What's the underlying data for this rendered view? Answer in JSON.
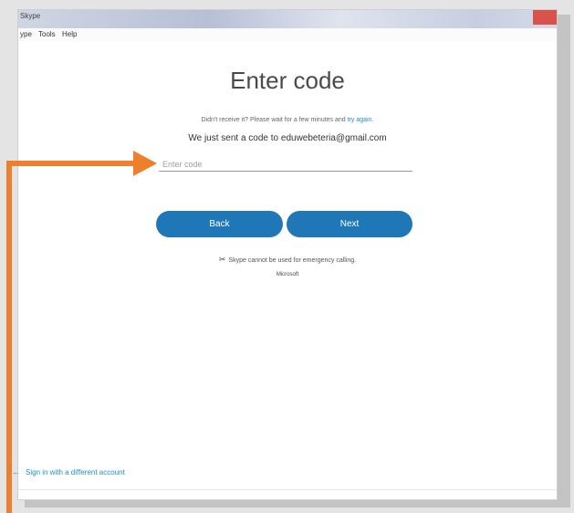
{
  "window": {
    "title": "Skype"
  },
  "menu": {
    "items": [
      "ype",
      "Tools",
      "Help"
    ]
  },
  "main": {
    "heading": "Enter code",
    "hint_text": "Didn't receive it? Please wait for a few minutes and ",
    "hint_link": "try again.",
    "sent_message": "We just sent a code to eduwebeteria@gmail.com",
    "code_placeholder": "Enter code",
    "code_value": "",
    "back_label": "Back",
    "next_label": "Next",
    "emergency_notice": "Skype cannot be used for emergency calling.",
    "brand": "Microsoft"
  },
  "footer": {
    "signin_link": "Sign in with a different account"
  },
  "colors": {
    "accent": "#1f77b8",
    "link": "#1b8fd1",
    "annotation": "#ee7f2d"
  }
}
